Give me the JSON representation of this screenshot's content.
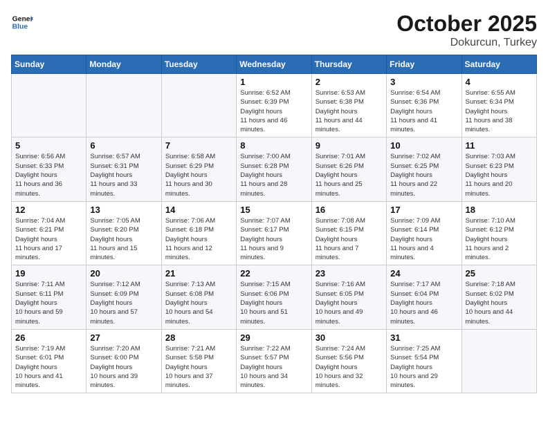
{
  "header": {
    "logo_line1": "General",
    "logo_line2": "Blue",
    "month": "October 2025",
    "location": "Dokurcun, Turkey"
  },
  "weekdays": [
    "Sunday",
    "Monday",
    "Tuesday",
    "Wednesday",
    "Thursday",
    "Friday",
    "Saturday"
  ],
  "weeks": [
    [
      null,
      null,
      null,
      {
        "day": 1,
        "sunrise": "6:52 AM",
        "sunset": "6:39 PM",
        "daylight": "11 hours and 46 minutes."
      },
      {
        "day": 2,
        "sunrise": "6:53 AM",
        "sunset": "6:38 PM",
        "daylight": "11 hours and 44 minutes."
      },
      {
        "day": 3,
        "sunrise": "6:54 AM",
        "sunset": "6:36 PM",
        "daylight": "11 hours and 41 minutes."
      },
      {
        "day": 4,
        "sunrise": "6:55 AM",
        "sunset": "6:34 PM",
        "daylight": "11 hours and 38 minutes."
      }
    ],
    [
      {
        "day": 5,
        "sunrise": "6:56 AM",
        "sunset": "6:33 PM",
        "daylight": "11 hours and 36 minutes."
      },
      {
        "day": 6,
        "sunrise": "6:57 AM",
        "sunset": "6:31 PM",
        "daylight": "11 hours and 33 minutes."
      },
      {
        "day": 7,
        "sunrise": "6:58 AM",
        "sunset": "6:29 PM",
        "daylight": "11 hours and 30 minutes."
      },
      {
        "day": 8,
        "sunrise": "7:00 AM",
        "sunset": "6:28 PM",
        "daylight": "11 hours and 28 minutes."
      },
      {
        "day": 9,
        "sunrise": "7:01 AM",
        "sunset": "6:26 PM",
        "daylight": "11 hours and 25 minutes."
      },
      {
        "day": 10,
        "sunrise": "7:02 AM",
        "sunset": "6:25 PM",
        "daylight": "11 hours and 22 minutes."
      },
      {
        "day": 11,
        "sunrise": "7:03 AM",
        "sunset": "6:23 PM",
        "daylight": "11 hours and 20 minutes."
      }
    ],
    [
      {
        "day": 12,
        "sunrise": "7:04 AM",
        "sunset": "6:21 PM",
        "daylight": "11 hours and 17 minutes."
      },
      {
        "day": 13,
        "sunrise": "7:05 AM",
        "sunset": "6:20 PM",
        "daylight": "11 hours and 15 minutes."
      },
      {
        "day": 14,
        "sunrise": "7:06 AM",
        "sunset": "6:18 PM",
        "daylight": "11 hours and 12 minutes."
      },
      {
        "day": 15,
        "sunrise": "7:07 AM",
        "sunset": "6:17 PM",
        "daylight": "11 hours and 9 minutes."
      },
      {
        "day": 16,
        "sunrise": "7:08 AM",
        "sunset": "6:15 PM",
        "daylight": "11 hours and 7 minutes."
      },
      {
        "day": 17,
        "sunrise": "7:09 AM",
        "sunset": "6:14 PM",
        "daylight": "11 hours and 4 minutes."
      },
      {
        "day": 18,
        "sunrise": "7:10 AM",
        "sunset": "6:12 PM",
        "daylight": "11 hours and 2 minutes."
      }
    ],
    [
      {
        "day": 19,
        "sunrise": "7:11 AM",
        "sunset": "6:11 PM",
        "daylight": "10 hours and 59 minutes."
      },
      {
        "day": 20,
        "sunrise": "7:12 AM",
        "sunset": "6:09 PM",
        "daylight": "10 hours and 57 minutes."
      },
      {
        "day": 21,
        "sunrise": "7:13 AM",
        "sunset": "6:08 PM",
        "daylight": "10 hours and 54 minutes."
      },
      {
        "day": 22,
        "sunrise": "7:15 AM",
        "sunset": "6:06 PM",
        "daylight": "10 hours and 51 minutes."
      },
      {
        "day": 23,
        "sunrise": "7:16 AM",
        "sunset": "6:05 PM",
        "daylight": "10 hours and 49 minutes."
      },
      {
        "day": 24,
        "sunrise": "7:17 AM",
        "sunset": "6:04 PM",
        "daylight": "10 hours and 46 minutes."
      },
      {
        "day": 25,
        "sunrise": "7:18 AM",
        "sunset": "6:02 PM",
        "daylight": "10 hours and 44 minutes."
      }
    ],
    [
      {
        "day": 26,
        "sunrise": "7:19 AM",
        "sunset": "6:01 PM",
        "daylight": "10 hours and 41 minutes."
      },
      {
        "day": 27,
        "sunrise": "7:20 AM",
        "sunset": "6:00 PM",
        "daylight": "10 hours and 39 minutes."
      },
      {
        "day": 28,
        "sunrise": "7:21 AM",
        "sunset": "5:58 PM",
        "daylight": "10 hours and 37 minutes."
      },
      {
        "day": 29,
        "sunrise": "7:22 AM",
        "sunset": "5:57 PM",
        "daylight": "10 hours and 34 minutes."
      },
      {
        "day": 30,
        "sunrise": "7:24 AM",
        "sunset": "5:56 PM",
        "daylight": "10 hours and 32 minutes."
      },
      {
        "day": 31,
        "sunrise": "7:25 AM",
        "sunset": "5:54 PM",
        "daylight": "10 hours and 29 minutes."
      },
      null
    ]
  ],
  "labels": {
    "sunrise": "Sunrise:",
    "sunset": "Sunset:",
    "daylight": "Daylight hours"
  }
}
